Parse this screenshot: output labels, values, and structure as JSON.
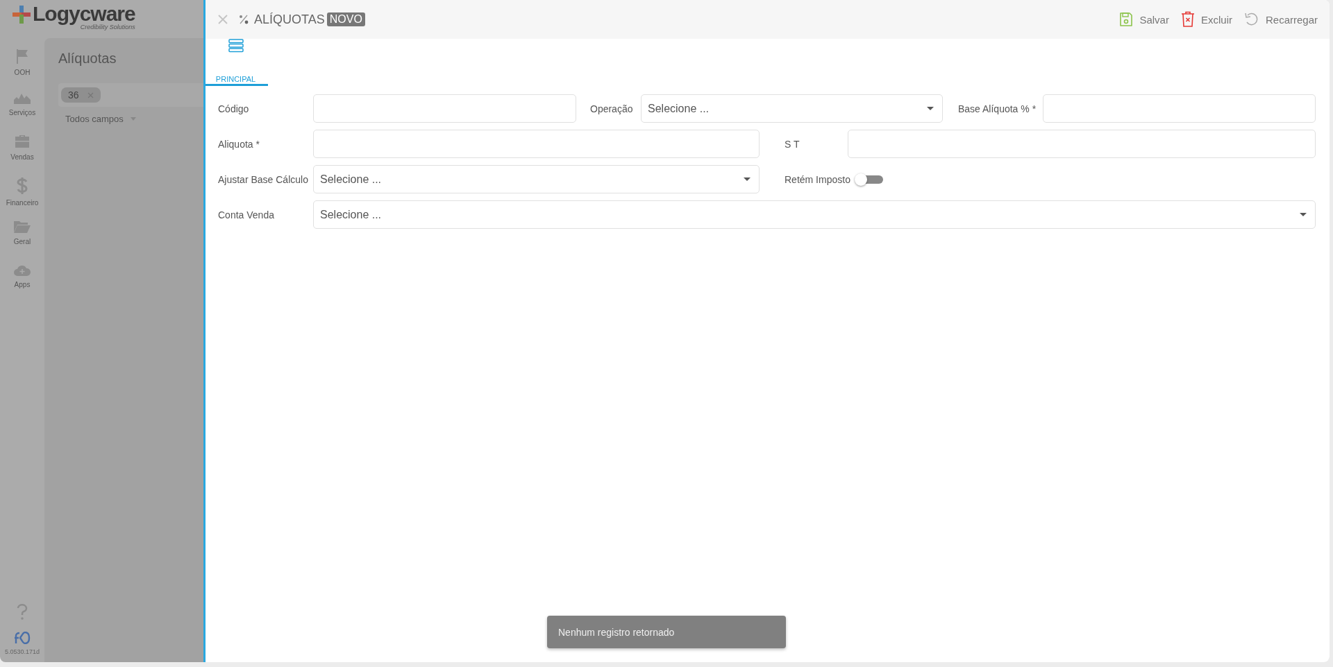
{
  "app": {
    "logo": {
      "name": "Logycware",
      "tagline": "Credibility Solutions"
    },
    "sidebar": {
      "items": [
        {
          "label": "OOH"
        },
        {
          "label": "Serviços"
        },
        {
          "label": "Vendas"
        },
        {
          "label": "Financeiro"
        },
        {
          "label": "Geral"
        },
        {
          "label": "Apps"
        }
      ],
      "version": "5.0530.171d"
    }
  },
  "background_page": {
    "title": "Alíquotas",
    "filter_chips": [
      {
        "label": "36"
      }
    ],
    "filter_field": "Todos campos"
  },
  "panel": {
    "title": "ALÍQUOTAS",
    "badge": "NOVO",
    "actions": [
      {
        "label": "Salvar",
        "kind": "save"
      },
      {
        "label": "Excluir",
        "kind": "delete"
      },
      {
        "label": "Recarregar",
        "kind": "reload"
      }
    ],
    "tabs": [
      {
        "label": "PRINCIPAL",
        "selected": true
      }
    ],
    "form": {
      "rows": [
        {
          "fields": [
            {
              "label": "Código",
              "kind": "text"
            },
            {
              "label": "Operação",
              "kind": "select",
              "placeholder": "Selecione ..."
            },
            {
              "label": "Base Alíquota % *",
              "kind": "text"
            }
          ]
        },
        {
          "fields": [
            {
              "label": "Aliquota *",
              "kind": "text"
            },
            {
              "label": "S T",
              "kind": "text"
            }
          ]
        },
        {
          "fields": [
            {
              "label": "Ajustar Base Cálculo",
              "kind": "select",
              "placeholder": "Selecione ..."
            },
            {
              "label": "Retém Imposto",
              "kind": "toggle",
              "on": false
            }
          ]
        },
        {
          "fields": [
            {
              "label": "Conta Venda",
              "kind": "select",
              "placeholder": "Selecione ..."
            }
          ]
        }
      ]
    }
  },
  "toast": {
    "message": "Nenhum registro retornado"
  }
}
